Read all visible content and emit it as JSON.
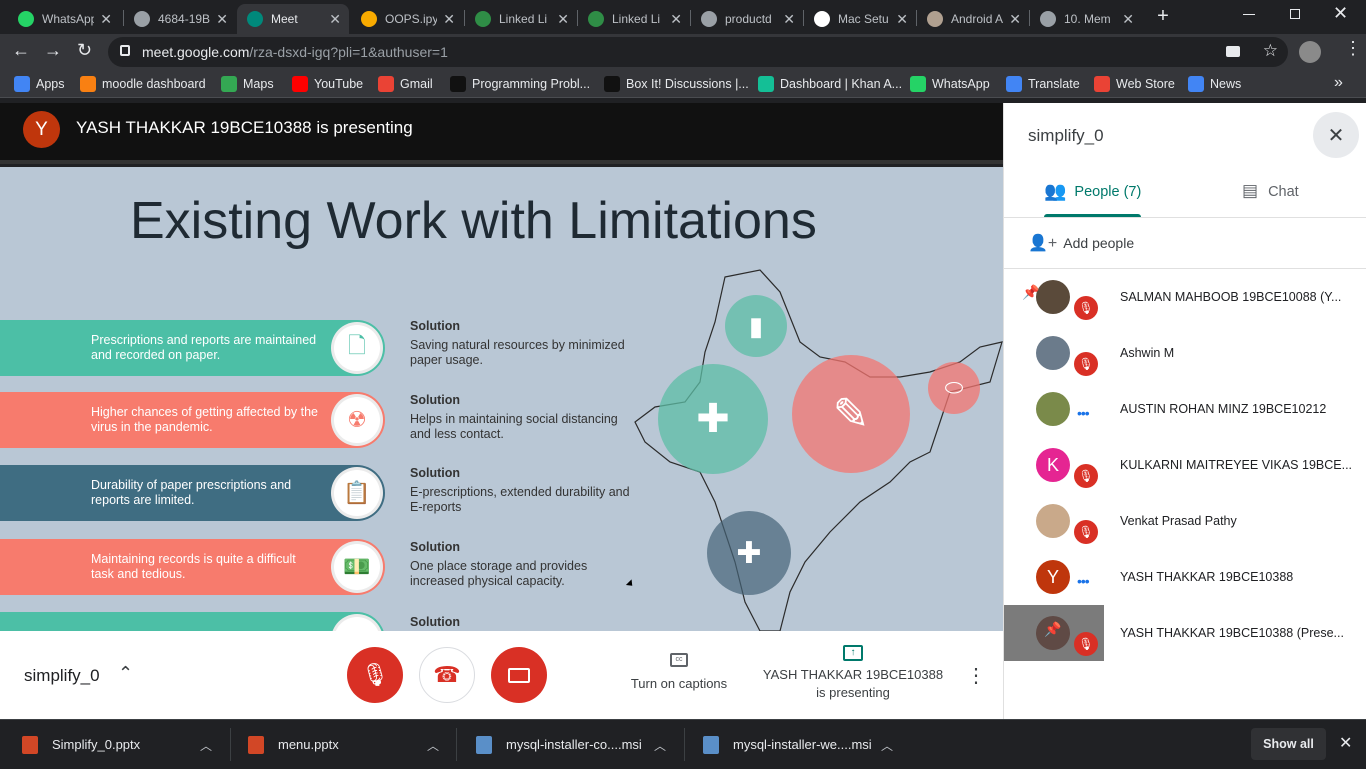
{
  "browser": {
    "tabs": [
      {
        "title": "WhatsApp",
        "color": "#25d366"
      },
      {
        "title": "4684-19B",
        "color": "#9aa0a6"
      },
      {
        "title": "Meet",
        "color": "#00897b",
        "active": true
      },
      {
        "title": "OOPS.ipy",
        "color": "#f9ab00"
      },
      {
        "title": "Linked Li",
        "color": "#2f8d46"
      },
      {
        "title": "Linked Li",
        "color": "#2f8d46"
      },
      {
        "title": "productd",
        "color": "#9aa0a6"
      },
      {
        "title": "Mac Setu",
        "color": "#ffffff"
      },
      {
        "title": "Android A",
        "color": "#b0a090"
      },
      {
        "title": "10. Mem",
        "color": "#9aa0a6"
      }
    ],
    "url_host": "meet.google.com",
    "url_path": "/rza-dsxd-igq?pli=1&authuser=1",
    "bookmarks": [
      {
        "label": "Apps",
        "color": "#4285f4"
      },
      {
        "label": "moodle dashboard",
        "color": "#f98012"
      },
      {
        "label": "Maps",
        "color": "#34a853"
      },
      {
        "label": "YouTube",
        "color": "#ff0000"
      },
      {
        "label": "Gmail",
        "color": "#ea4335"
      },
      {
        "label": "Programming Probl...",
        "color": "#111111"
      },
      {
        "label": "Box It! Discussions |...",
        "color": "#111111"
      },
      {
        "label": "Dashboard | Khan A...",
        "color": "#14bf96"
      },
      {
        "label": "WhatsApp",
        "color": "#25d366"
      },
      {
        "label": "Translate",
        "color": "#4285f4"
      },
      {
        "label": "Web Store",
        "color": "#ea4335"
      },
      {
        "label": "News",
        "color": "#4285f4"
      }
    ],
    "more_bookmarks": "»"
  },
  "meet": {
    "presenter_initial": "Y",
    "presenting_text": "YASH THAKKAR 19BCE10388 is presenting",
    "meeting_name": "simplify_0",
    "captions_label": "Turn on captions",
    "presenting_label_line1": "YASH THAKKAR 19BCE10388",
    "presenting_label_line2": "is presenting",
    "slide": {
      "title": "Existing Work with Limitations",
      "rows": [
        {
          "text": "Prescriptions and reports are maintained and recorded on paper.",
          "color": "#4cbfa6",
          "sol_title": "Solution",
          "sol_text": "Saving natural resources by minimized paper usage."
        },
        {
          "text": "Higher chances of getting affected by the virus  in the pandemic.",
          "color": "#f77b6d",
          "sol_title": "Solution",
          "sol_text": "Helps in maintaining social distancing and less contact."
        },
        {
          "text": "Durability of paper prescriptions and reports are limited.",
          "color": "#3f6d82",
          "sol_title": "Solution",
          "sol_text": "E-prescriptions, extended durability and E-reports"
        },
        {
          "text": "Maintaining records is quite a difficult task and tedious.",
          "color": "#f77b6d",
          "sol_title": "Solution",
          "sol_text": "One place storage and provides increased physical capacity."
        },
        {
          "text": "",
          "color": "#4cbfa6",
          "sol_title": "Solution",
          "sol_text": ""
        }
      ]
    }
  },
  "panel": {
    "title": "simplify_0",
    "people_tab": "People (7)",
    "chat_tab": "Chat",
    "add_people": "Add people",
    "participants": [
      {
        "name": "SALMAN MAHBOOB 19BCE10088 (Y...",
        "avatar_color": "#5a4a3a",
        "initial": ""
      },
      {
        "name": "Ashwin M",
        "avatar_color": "#6b7b8b",
        "initial": ""
      },
      {
        "name": "AUSTIN ROHAN MINZ 19BCE10212",
        "avatar_color": "#7a8a4a",
        "initial": ""
      },
      {
        "name": "KULKARNI MAITREYEE VIKAS 19BCE...",
        "avatar_color": "#e52592",
        "initial": "K"
      },
      {
        "name": "Venkat Prasad Pathy",
        "avatar_color": "#c9a98a",
        "initial": ""
      },
      {
        "name": "YASH THAKKAR 19BCE10388",
        "avatar_color": "#bf360c",
        "initial": "Y"
      },
      {
        "name": "YASH THAKKAR 19BCE10388 (Prese...",
        "avatar_color": "#5f4a45",
        "initial": ""
      }
    ]
  },
  "downloads": {
    "items": [
      {
        "name": "Simplify_0.pptx",
        "color": "#d24726"
      },
      {
        "name": "menu.pptx",
        "color": "#d24726"
      },
      {
        "name": "mysql-installer-co....msi",
        "color": "#5a8fc8"
      },
      {
        "name": "mysql-installer-we....msi",
        "color": "#5a8fc8"
      }
    ],
    "show_all": "Show all"
  }
}
